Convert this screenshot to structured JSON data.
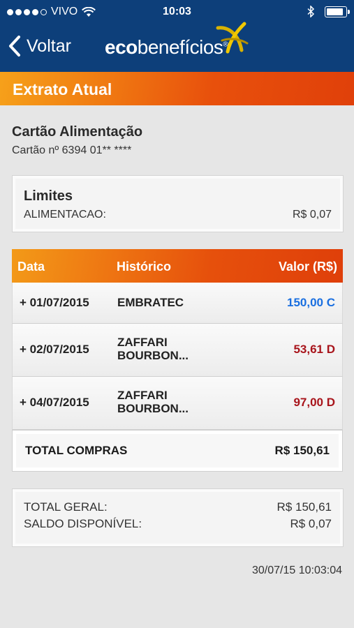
{
  "status_bar": {
    "carrier": "VIVO",
    "time": "10:03",
    "signal_dots": 4
  },
  "nav": {
    "back_label": "Voltar",
    "logo_bold": "eco",
    "logo_rest": "benefícios",
    "logo_reg": "®"
  },
  "section_title": "Extrato Atual",
  "card": {
    "name": "Cartão Alimentação",
    "number": "Cartão nº 6394 01** ****"
  },
  "limits": {
    "heading": "Limites",
    "label": "ALIMENTACAO:",
    "value": "R$ 0,07"
  },
  "table": {
    "headers": {
      "date": "Data",
      "history": "Histórico",
      "value": "Valor (R$)"
    },
    "rows": [
      {
        "date": "01/07/2015",
        "history": [
          "EMBRATEC"
        ],
        "value": "150,00 C",
        "type": "credit"
      },
      {
        "date": "02/07/2015",
        "history": [
          "ZAFFARI",
          "BOURBON..."
        ],
        "value": "53,61 D",
        "type": "debit"
      },
      {
        "date": "04/07/2015",
        "history": [
          "ZAFFARI",
          "BOURBON..."
        ],
        "value": "97,00 D",
        "type": "debit"
      }
    ],
    "total_label": "TOTAL COMPRAS",
    "total_value": "R$ 150,61"
  },
  "summary": {
    "total_label": "TOTAL GERAL:",
    "total_value": "R$ 150,61",
    "balance_label": "SALDO DISPONÍVEL:",
    "balance_value": "R$ 0,07"
  },
  "timestamp": "30/07/15 10:03:04",
  "colors": {
    "nav_blue": "#0d3f7a",
    "orange": "#ee7512",
    "credit": "#1a6fe0",
    "debit": "#a8141b"
  }
}
